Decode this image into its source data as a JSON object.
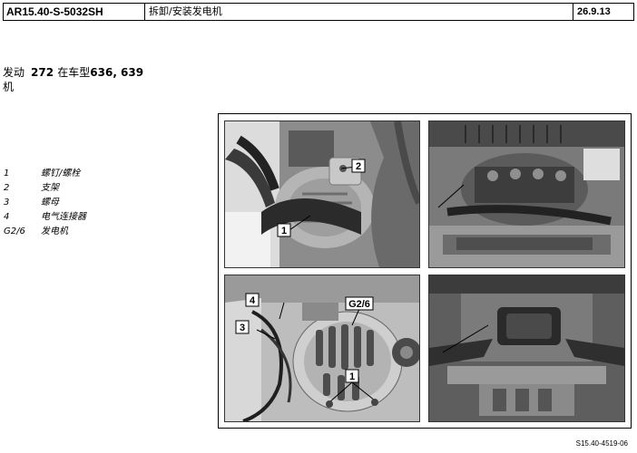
{
  "header": {
    "doc_id": "AR15.40-S-5032SH",
    "title": "拆卸/安装发电机",
    "date": "26.9.13"
  },
  "section": {
    "label": "发动机",
    "engine": "272",
    "vehicle_text": "在车型",
    "models": "636, 639"
  },
  "legend": [
    {
      "num": "1",
      "text": "螺钉/螺栓"
    },
    {
      "num": "2",
      "text": "支架"
    },
    {
      "num": "3",
      "text": "螺母"
    },
    {
      "num": "4",
      "text": "电气连接器"
    },
    {
      "num": "G2/6",
      "text": "发电机"
    }
  ],
  "callouts": {
    "p1_1": "1",
    "p1_2": "2",
    "p3_4": "4",
    "p3_3": "3",
    "p3_g26": "G2/6",
    "p3_1": "1"
  },
  "figure_id": "S15.40-4519-06"
}
